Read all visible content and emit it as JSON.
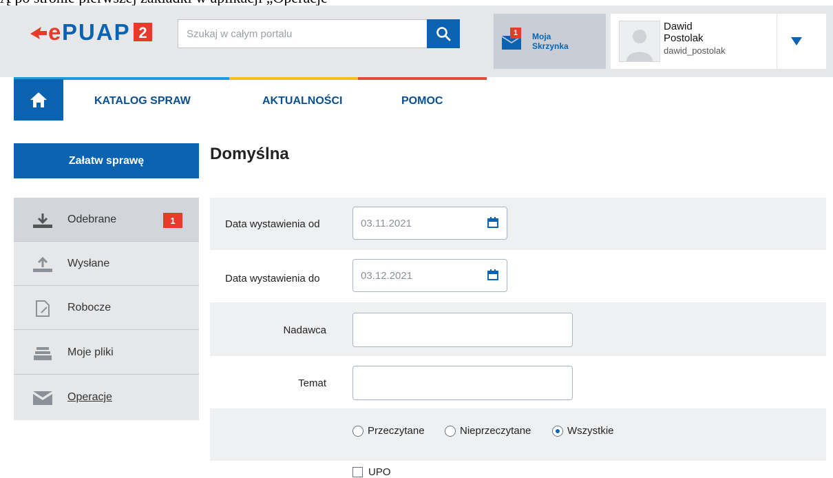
{
  "top_cut_text": "Ą po stronie pierwszej zakładki w aplikacji „Operacje",
  "header": {
    "logo_text": "ePUAP",
    "logo_version": "2",
    "search": {
      "placeholder": "Szukaj w całym portalu",
      "value": ""
    },
    "inbox": {
      "label_line1": "Moja",
      "label_line2": "Skrzynka",
      "badge": "1"
    },
    "user": {
      "first_name": "Dawid",
      "last_name": "Postolak",
      "login": "dawid_postolak"
    }
  },
  "nav": {
    "home_icon": "home-icon",
    "items": [
      {
        "label": "KATALOG SPRAW"
      },
      {
        "label": "AKTUALNOŚCI"
      },
      {
        "label": "POMOC"
      }
    ]
  },
  "stripe_colors": [
    "#1b9ad6",
    "#f3c01b",
    "#e64a3b"
  ],
  "sidebar": {
    "cta": "Załatw sprawę",
    "items": [
      {
        "label": "Odebrane",
        "icon": "download-icon",
        "badge": "1",
        "active": true
      },
      {
        "label": "Wysłane",
        "icon": "upload-icon"
      },
      {
        "label": "Robocze",
        "icon": "draft-icon"
      },
      {
        "label": "Moje pliki",
        "icon": "files-icon"
      },
      {
        "label": "Operacje",
        "icon": "envelope-icon"
      }
    ]
  },
  "main": {
    "title": "Domyślna",
    "filters": {
      "date_from": {
        "label": "Data wystawienia od",
        "value": "03.11.2021"
      },
      "date_to": {
        "label": "Data wystawienia do",
        "value": "03.12.2021"
      },
      "sender": {
        "label": "Nadawca",
        "value": ""
      },
      "subject": {
        "label": "Temat",
        "value": ""
      },
      "read_status": {
        "options": [
          "Przeczytane",
          "Nieprzeczytane",
          "Wszystkie"
        ],
        "selected": "Wszystkie"
      },
      "upo": {
        "label": "UPO",
        "checked": false
      }
    }
  },
  "colors": {
    "primary": "#0a63b0",
    "badge": "#e63a2b",
    "header_bg": "#e6e7e9"
  }
}
